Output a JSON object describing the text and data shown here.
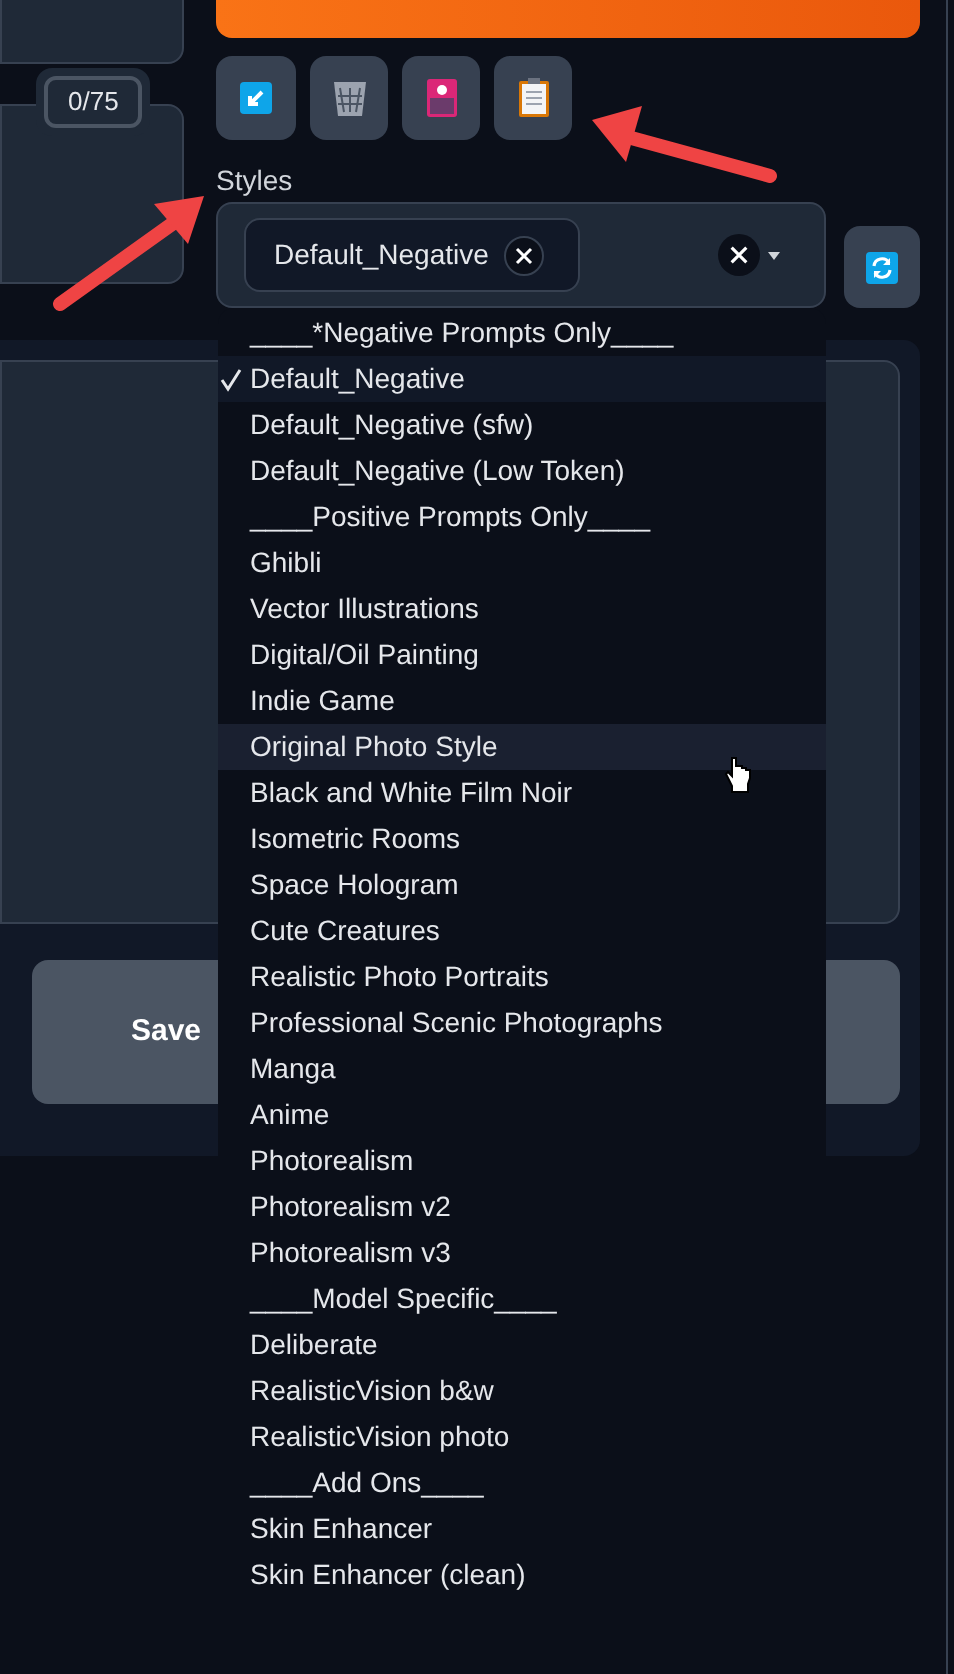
{
  "token_counter": "0/75",
  "styles": {
    "label": "Styles",
    "chips": [
      {
        "label": "Default_Negative"
      }
    ],
    "options": [
      {
        "label": "____*Negative Prompts Only____",
        "selected": false,
        "highlighted": false
      },
      {
        "label": "Default_Negative",
        "selected": true,
        "highlighted": false
      },
      {
        "label": "Default_Negative (sfw)",
        "selected": false,
        "highlighted": false
      },
      {
        "label": "Default_Negative (Low Token)",
        "selected": false,
        "highlighted": false
      },
      {
        "label": "____Positive Prompts Only____",
        "selected": false,
        "highlighted": false
      },
      {
        "label": "Ghibli",
        "selected": false,
        "highlighted": false
      },
      {
        "label": "Vector Illustrations",
        "selected": false,
        "highlighted": false
      },
      {
        "label": "Digital/Oil Painting",
        "selected": false,
        "highlighted": false
      },
      {
        "label": "Indie Game",
        "selected": false,
        "highlighted": false
      },
      {
        "label": "Original Photo Style",
        "selected": false,
        "highlighted": true
      },
      {
        "label": "Black and White Film Noir",
        "selected": false,
        "highlighted": false
      },
      {
        "label": "Isometric Rooms",
        "selected": false,
        "highlighted": false
      },
      {
        "label": "Space Hologram",
        "selected": false,
        "highlighted": false
      },
      {
        "label": "Cute Creatures",
        "selected": false,
        "highlighted": false
      },
      {
        "label": "Realistic Photo Portraits",
        "selected": false,
        "highlighted": false
      },
      {
        "label": "Professional Scenic Photographs",
        "selected": false,
        "highlighted": false
      },
      {
        "label": "Manga",
        "selected": false,
        "highlighted": false
      },
      {
        "label": "Anime",
        "selected": false,
        "highlighted": false
      },
      {
        "label": "Photorealism",
        "selected": false,
        "highlighted": false
      },
      {
        "label": "Photorealism v2",
        "selected": false,
        "highlighted": false
      },
      {
        "label": "Photorealism v3",
        "selected": false,
        "highlighted": false
      },
      {
        "label": "____Model Specific____",
        "selected": false,
        "highlighted": false
      },
      {
        "label": "Deliberate",
        "selected": false,
        "highlighted": false
      },
      {
        "label": "RealisticVision b&w",
        "selected": false,
        "highlighted": false
      },
      {
        "label": "RealisticVision photo",
        "selected": false,
        "highlighted": false
      },
      {
        "label": "____Add Ons____",
        "selected": false,
        "highlighted": false
      },
      {
        "label": "Skin Enhancer",
        "selected": false,
        "highlighted": false
      },
      {
        "label": "Skin Enhancer (clean)",
        "selected": false,
        "highlighted": false
      }
    ]
  },
  "save_button": {
    "label": "Save"
  }
}
